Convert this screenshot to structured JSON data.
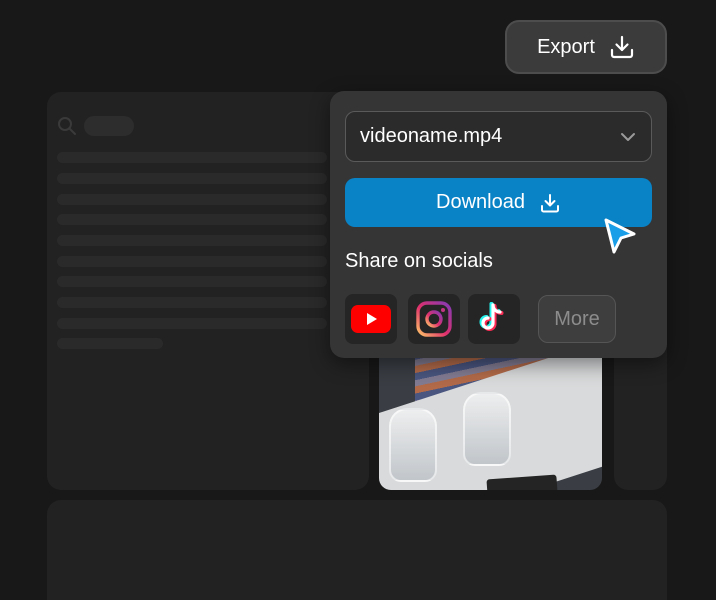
{
  "header": {
    "export_label": "Export",
    "export_icon": "download-icon"
  },
  "export_menu": {
    "file_select": {
      "value": "videoname.mp4",
      "icon": "chevron-down-icon"
    },
    "download_label": "Download",
    "download_icon": "download-icon",
    "share_title": "Share on socials",
    "socials": [
      {
        "name": "YouTube",
        "icon": "youtube-icon"
      },
      {
        "name": "Instagram",
        "icon": "instagram-icon"
      },
      {
        "name": "TikTok",
        "icon": "tiktok-icon"
      }
    ],
    "more_label": "More"
  },
  "colors": {
    "accent": "#0a82c6",
    "background": "#181818",
    "popup": "#353535"
  }
}
